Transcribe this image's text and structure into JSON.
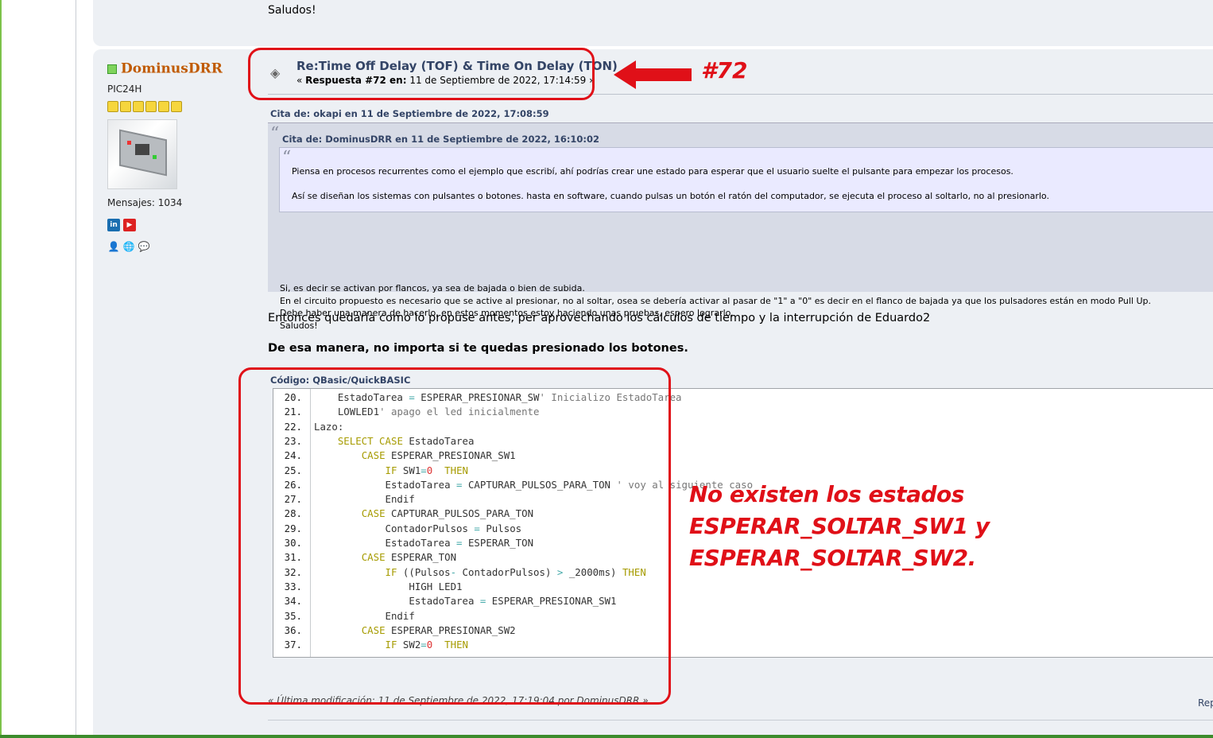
{
  "prev_post": {
    "closing": "Saludos!"
  },
  "poster": {
    "username": "DominusDRR",
    "rank": "PIC24H",
    "star_count": 6,
    "messages": "Mensajes: 1034",
    "social_icons": [
      "linkedin-icon",
      "youtube-icon"
    ],
    "profile_icons": [
      "profile-icon",
      "website-icon",
      "pm-icon"
    ]
  },
  "post": {
    "title": "Re:Time Off Delay (TOF) & Time On Delay (TON)",
    "meta_prefix": "« ",
    "meta_label": "Respuesta #72 en:",
    "meta_date": " 11 de Septiembre de 2022, 17:14:59 »"
  },
  "quote_outer": {
    "header": "Cita de: okapi en 11 de Septiembre de 2022, 17:08:59",
    "lines": [
      "Si, es decir se activan por flancos, ya sea de bajada o bien de subida.",
      "En el circuito propuesto es necesario que se active al presionar, no al soltar, osea se debería activar al pasar de \"1\" a \"0\" es decir en el flanco de bajada ya que los pulsadores están en modo Pull Up.",
      "Debe haber una manera de hacerlo, en estos momentos estoy haciendo unas pruebas, espero lograrlo.",
      "Saludos!"
    ]
  },
  "quote_inner": {
    "header": "Cita de: DominusDRR en 11 de Septiembre de 2022, 16:10:02",
    "lines": [
      "Piensa en procesos recurrentes como el ejemplo que escribí, ahí podrías crear une estado para esperar que el usuario suelte el pulsante para empezar los procesos.",
      "Así se diseñan los sistemas con pulsantes o botones. hasta en software, cuando pulsas un botón el ratón del computador, se ejecuta el proceso al soltarlo, no al presionarlo."
    ]
  },
  "body": {
    "line1": "Entonces quedaría como lo propuse antes, per aprovechando los cálculos de tiempo y la interrupción de Eduardo2",
    "line2": "De esa manera, no importa si te quedas presionado los botones."
  },
  "code": {
    "header": "Código: QBasic/QuickBASIC",
    "lines": [
      {
        "n": "20.",
        "t": "    EstadoTarea = ESPERAR_PRESIONAR_SW' Inicializo EstadoTarea"
      },
      {
        "n": "21.",
        "t": "    LOWLED1' apago el led inicialmente"
      },
      {
        "n": "22.",
        "t": "Lazo:"
      },
      {
        "n": "23.",
        "t": "    SELECT CASE EstadoTarea"
      },
      {
        "n": "24.",
        "t": "        CASE ESPERAR_PRESIONAR_SW1"
      },
      {
        "n": "25.",
        "t": "            IF SW1=0  THEN"
      },
      {
        "n": "26.",
        "t": "            EstadoTarea = CAPTURAR_PULSOS_PARA_TON ' voy al siguiente caso"
      },
      {
        "n": "27.",
        "t": "            Endif"
      },
      {
        "n": "28.",
        "t": "        CASE CAPTURAR_PULSOS_PARA_TON"
      },
      {
        "n": "29.",
        "t": "            ContadorPulsos = Pulsos"
      },
      {
        "n": "30.",
        "t": "            EstadoTarea = ESPERAR_TON"
      },
      {
        "n": "31.",
        "t": "        CASE ESPERAR_TON"
      },
      {
        "n": "32.",
        "t": "            IF ((Pulsos- ContadorPulsos) > _2000ms) THEN"
      },
      {
        "n": "33.",
        "t": "                HIGH LED1"
      },
      {
        "n": "34.",
        "t": "                EstadoTarea = ESPERAR_PRESIONAR_SW1"
      },
      {
        "n": "35.",
        "t": "            Endif"
      },
      {
        "n": "36.",
        "t": "        CASE ESPERAR_PRESIONAR_SW2"
      },
      {
        "n": "37.",
        "t": "            IF SW2=0  THEN"
      }
    ]
  },
  "last_modified": "« Última modificación: 11 de Septiembre de 2022, 17:19:04 por DominusDRR »",
  "reply_link": "Rep",
  "annotations": {
    "number": "#72",
    "line1": "No existen los estados",
    "line2": "ESPERAR_SOLTAR_SW1 y",
    "line3": "ESPERAR_SOLTAR_SW2.",
    "color": "#e01018"
  }
}
